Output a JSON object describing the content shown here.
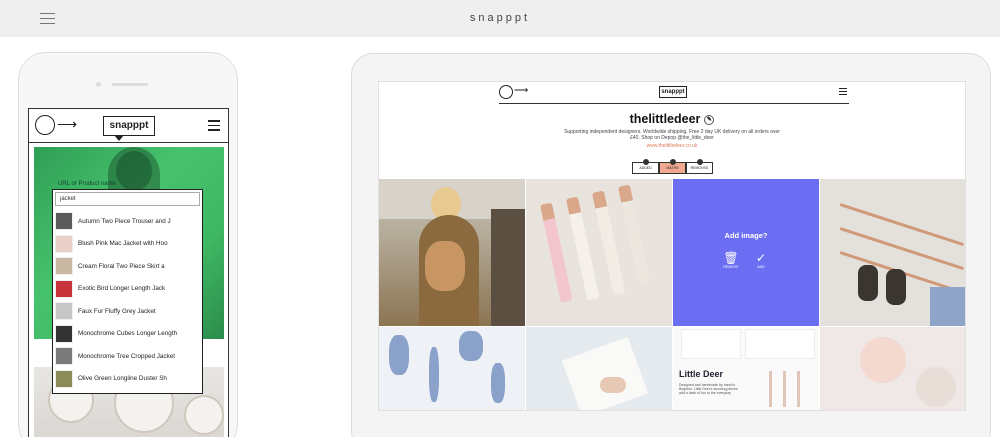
{
  "site": {
    "brand": "snapppt"
  },
  "phone": {
    "logo": "snapppt",
    "url_label": "URL or Product name",
    "search_value": "jacket",
    "products": [
      {
        "label": "Autumn Two Piece Trouser and J",
        "color": "#5a5a5a"
      },
      {
        "label": "Blush Pink Mac Jacket with Hoo",
        "color": "#e8cfc8"
      },
      {
        "label": "Cream Floral Two Piece Skirt a",
        "color": "#c9b8a4"
      },
      {
        "label": "Exotic Bird Longer Length Jack",
        "color": "#c9343c"
      },
      {
        "label": "Faux Fur Fluffy Grey Jacket",
        "color": "#c7c7c7"
      },
      {
        "label": "Monochrome Cubes Longer Length",
        "color": "#333333"
      },
      {
        "label": "Monochrome Tree Cropped Jacket",
        "color": "#7a7a7a"
      },
      {
        "label": "Olive Green Longline Duster Sh",
        "color": "#8b8b5a"
      }
    ]
  },
  "tablet": {
    "logo": "snapppt",
    "username": "thelittledeer",
    "bio_line1": "Supporting independent designers. Worldwide shipping. Free 2 day UK delivery on all orders over",
    "bio_line2": "£40. Shop on Depop @the_little_deer",
    "link": "www.thelittledeer.co.uk",
    "buttons": [
      "ADDED",
      "MATHS",
      "REMOVED"
    ],
    "add_image": {
      "title": "Add image?",
      "remove_label": "REMOVE",
      "add_label": "ADD"
    },
    "tile7": {
      "heading": "Little Deer",
      "caption": "Designed and handmade by hand in Brighton. Little Deer's stunning pieces add a dash of fun to the everyday"
    }
  },
  "colors": {
    "accent": "#f0a98f",
    "phone_hero": "#3fb863",
    "add_tile": "#6b6ef2"
  }
}
